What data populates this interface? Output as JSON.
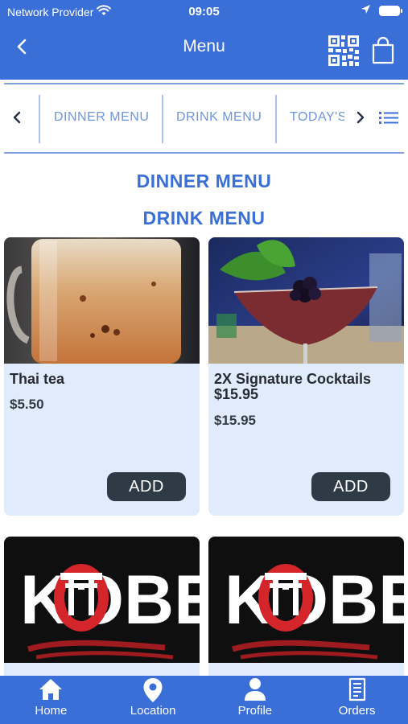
{
  "status_bar": {
    "carrier": "Network Provider",
    "time": "09:05"
  },
  "header": {
    "title": "Menu",
    "back_icon": "chevron-left-icon",
    "qr_icon": "qr-code-icon",
    "bag_icon": "shopping-bag-icon"
  },
  "category_tabs": {
    "items": [
      {
        "label": "DINNER MENU"
      },
      {
        "label": "DRINK MENU"
      },
      {
        "label": "TODAY'S"
      }
    ],
    "prev_icon": "chevron-left-icon",
    "next_icon": "chevron-right-icon",
    "list_icon": "list-icon"
  },
  "sections": [
    {
      "title": "DINNER MENU"
    },
    {
      "title": "DRINK MENU"
    }
  ],
  "products": [
    {
      "name": "Thai tea",
      "price": "$5.50",
      "add_label": "ADD"
    },
    {
      "name": "2X Signature Cocktails $15.95",
      "price": "$15.95",
      "add_label": "ADD"
    },
    {
      "logo_text": "KOBE"
    },
    {
      "logo_text": "KOBE"
    }
  ],
  "bottom_nav": [
    {
      "label": "Home",
      "icon": "home-icon"
    },
    {
      "label": "Location",
      "icon": "location-pin-icon"
    },
    {
      "label": "Profile",
      "icon": "profile-icon"
    },
    {
      "label": "Orders",
      "icon": "orders-receipt-icon"
    }
  ],
  "colors": {
    "primary": "#3a6fd8",
    "card_background": "#e0ecfb",
    "button_dark": "#2f3a47",
    "tab_text": "#6e95dc",
    "logo_red": "#d4262a"
  }
}
